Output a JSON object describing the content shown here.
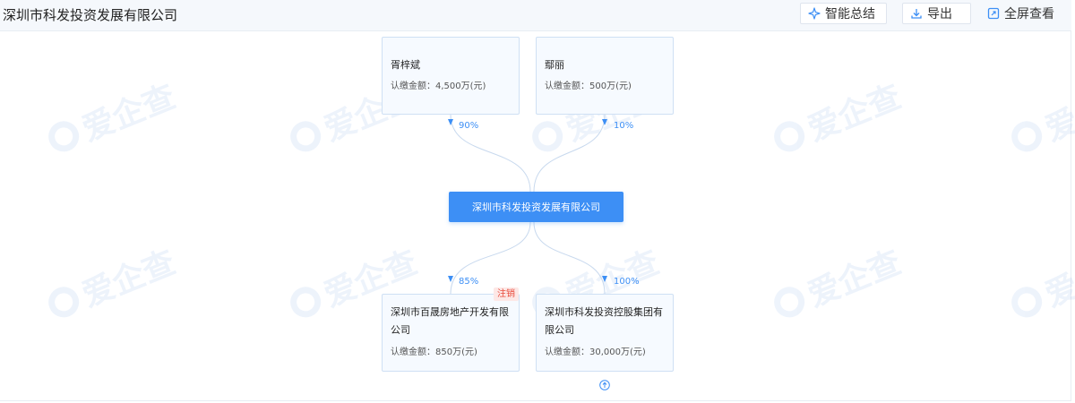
{
  "header": {
    "title": "深圳市科发投资发展有限公司",
    "buttons": {
      "smart_summary": "智能总结",
      "export": "导出",
      "fullscreen": "全屏查看"
    }
  },
  "watermark": {
    "text": "爱企查"
  },
  "graph": {
    "center": {
      "name": "深圳市科发投资发展有限公司"
    },
    "shareholders": [
      {
        "name": "胥梓斌",
        "amount": "认缴金额：4,500万(元)",
        "percent": "90%"
      },
      {
        "name": "鄢丽",
        "amount": "认缴金额：500万(元)",
        "percent": "10%"
      }
    ],
    "investments": [
      {
        "name": "深圳市百晟房地产开发有限公司",
        "amount": "认缴金额：850万(元)",
        "percent": "85%",
        "tag": "注销"
      },
      {
        "name": "深圳市科发投资控股集团有限公司",
        "amount": "认缴金额：30,000万(元)",
        "percent": "100%"
      }
    ]
  },
  "colors": {
    "accent": "#3d8ff5",
    "node_border": "#cfe0f4",
    "node_bg": "#f6faff",
    "tag_text": "#e84b3c",
    "tag_bg": "#fde8e6",
    "watermark": "#1463d6"
  },
  "icons": {
    "smart_summary": "sparkle-icon",
    "export": "download-icon",
    "fullscreen": "fullscreen-icon",
    "expand": "expand-arrow-icon"
  }
}
